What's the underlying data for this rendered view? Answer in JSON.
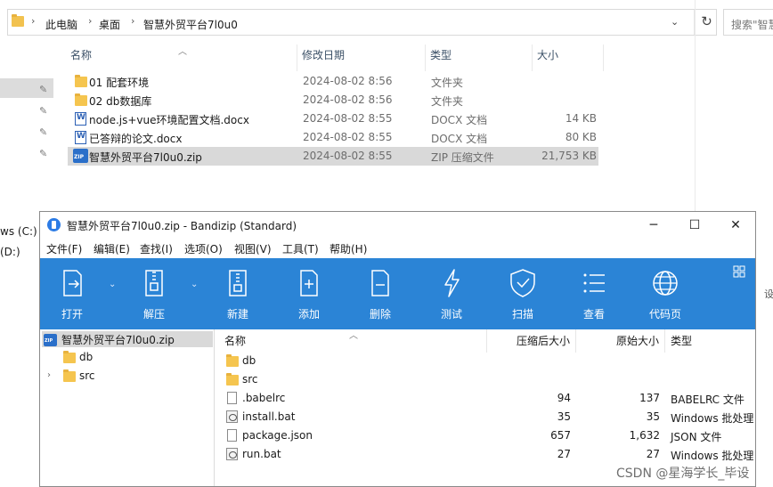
{
  "explorer": {
    "breadcrumb": [
      "此电脑",
      "桌面",
      "智慧外贸平台7l0u0"
    ],
    "search_placeholder": "搜索\"智慧",
    "drives": [
      "ws (C:)",
      "(D:)"
    ],
    "columns": [
      "名称",
      "修改日期",
      "类型",
      "大小"
    ],
    "files": [
      {
        "name": "01  配套环境",
        "date": "2024-08-02 8:56",
        "type": "文件夹",
        "size": "",
        "icon": "folder-icon"
      },
      {
        "name": "02 db数据库",
        "date": "2024-08-02 8:56",
        "type": "文件夹",
        "size": "",
        "icon": "folder-icon"
      },
      {
        "name": "node.js+vue环境配置文档.docx",
        "date": "2024-08-02 8:55",
        "type": "DOCX 文档",
        "size": "14 KB",
        "icon": "docx-icon"
      },
      {
        "name": "已答辩的论文.docx",
        "date": "2024-08-02 8:55",
        "type": "DOCX 文档",
        "size": "80 KB",
        "icon": "docx-icon"
      },
      {
        "name": "智慧外贸平台7l0u0.zip",
        "date": "2024-08-02 8:55",
        "type": "ZIP 压缩文件",
        "size": "21,753 KB",
        "icon": "zip-icon"
      }
    ],
    "edge_text": "设"
  },
  "bandizip": {
    "title": "智慧外贸平台7l0u0.zip - Bandizip (Standard)",
    "menu": [
      "文件(F)",
      "编辑(E)",
      "查找(I)",
      "选项(O)",
      "视图(V)",
      "工具(T)",
      "帮助(H)"
    ],
    "toolbar": [
      "打开",
      "解压",
      "新建",
      "添加",
      "删除",
      "测试",
      "扫描",
      "查看",
      "代码页"
    ],
    "tree": {
      "root": "智慧外贸平台7l0u0.zip",
      "children": [
        "db",
        "src"
      ]
    },
    "list_columns": [
      "名称",
      "压缩后大小",
      "原始大小",
      "类型"
    ],
    "entries": [
      {
        "name": "db",
        "packed": "",
        "size": "",
        "type": "",
        "icon": "folder-icon"
      },
      {
        "name": "src",
        "packed": "",
        "size": "",
        "type": "",
        "icon": "folder-icon"
      },
      {
        "name": ".babelrc",
        "packed": "94",
        "size": "137",
        "type": "BABELRC 文件",
        "icon": "file-icon"
      },
      {
        "name": "install.bat",
        "packed": "35",
        "size": "35",
        "type": "Windows 批处理",
        "icon": "bat-icon"
      },
      {
        "name": "package.json",
        "packed": "657",
        "size": "1,632",
        "type": "JSON 文件",
        "icon": "file-icon"
      },
      {
        "name": "run.bat",
        "packed": "27",
        "size": "27",
        "type": "Windows 批处理",
        "icon": "bat-icon"
      }
    ]
  },
  "watermark": "CSDN @星海学长_毕设",
  "colors": {
    "toolbar": "#2b84d6",
    "selection": "#d9d9d9",
    "folder": "#f5c54f"
  }
}
